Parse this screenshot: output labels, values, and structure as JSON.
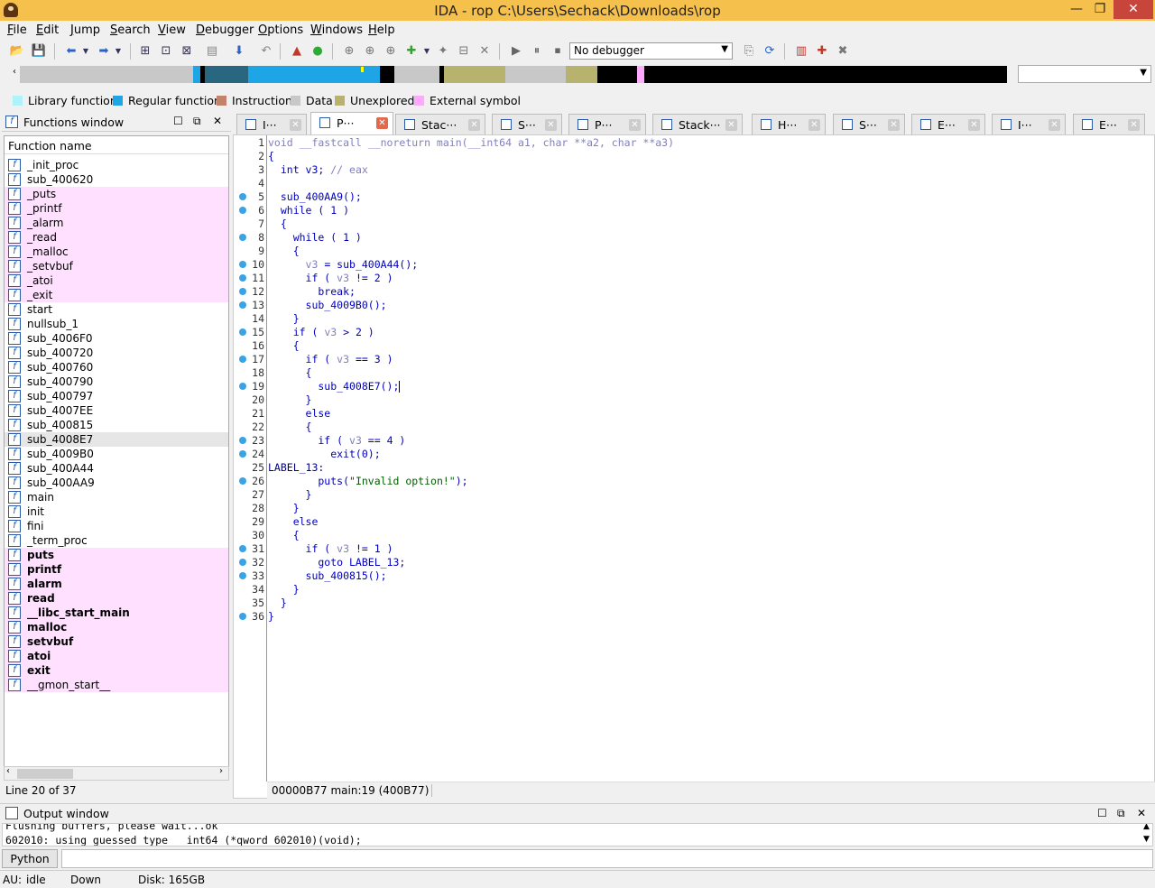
{
  "window": {
    "title": "IDA - rop C:\\Users\\Sechack\\Downloads\\rop",
    "min": "—",
    "max": "❐",
    "close": "✕"
  },
  "menu": [
    "File",
    "Edit",
    "Jump",
    "Search",
    "View",
    "Debugger",
    "Options",
    "Windows",
    "Help"
  ],
  "toolbar": {
    "debugger_select": "No debugger"
  },
  "legend": [
    {
      "label": "Library function",
      "color": "#aef3fb"
    },
    {
      "label": "Regular function",
      "color": "#1ea5e6"
    },
    {
      "label": "Instruction",
      "color": "#c3826c"
    },
    {
      "label": "Data",
      "color": "#c8c8c8"
    },
    {
      "label": "Unexplored",
      "color": "#b7b36e"
    },
    {
      "label": "External symbol",
      "color": "#ffaaff"
    }
  ],
  "functions_window": {
    "title": "Functions window",
    "column": "Function name",
    "status": "Line 20 of 37",
    "items": [
      {
        "name": "_init_proc",
        "style": "normal"
      },
      {
        "name": "sub_400620",
        "style": "normal"
      },
      {
        "name": "_puts",
        "style": "pink"
      },
      {
        "name": "_printf",
        "style": "pink"
      },
      {
        "name": "_alarm",
        "style": "pink"
      },
      {
        "name": "_read",
        "style": "pink"
      },
      {
        "name": "_malloc",
        "style": "pink"
      },
      {
        "name": "_setvbuf",
        "style": "pink"
      },
      {
        "name": "_atoi",
        "style": "pink"
      },
      {
        "name": "_exit",
        "style": "pink"
      },
      {
        "name": "start",
        "style": "normal"
      },
      {
        "name": "nullsub_1",
        "style": "normal"
      },
      {
        "name": "sub_4006F0",
        "style": "normal"
      },
      {
        "name": "sub_400720",
        "style": "normal"
      },
      {
        "name": "sub_400760",
        "style": "normal"
      },
      {
        "name": "sub_400790",
        "style": "normal"
      },
      {
        "name": "sub_400797",
        "style": "normal"
      },
      {
        "name": "sub_4007EE",
        "style": "normal"
      },
      {
        "name": "sub_400815",
        "style": "normal"
      },
      {
        "name": "sub_4008E7",
        "style": "selected"
      },
      {
        "name": "sub_4009B0",
        "style": "normal"
      },
      {
        "name": "sub_400A44",
        "style": "normal"
      },
      {
        "name": "sub_400AA9",
        "style": "normal"
      },
      {
        "name": "main",
        "style": "normal"
      },
      {
        "name": "init",
        "style": "normal"
      },
      {
        "name": "fini",
        "style": "normal"
      },
      {
        "name": "_term_proc",
        "style": "normal"
      },
      {
        "name": "puts",
        "style": "pinkbold"
      },
      {
        "name": "printf",
        "style": "pinkbold"
      },
      {
        "name": "alarm",
        "style": "pinkbold"
      },
      {
        "name": "read",
        "style": "pinkbold"
      },
      {
        "name": "__libc_start_main",
        "style": "pinkbold"
      },
      {
        "name": "malloc",
        "style": "pinkbold"
      },
      {
        "name": "setvbuf",
        "style": "pinkbold"
      },
      {
        "name": "atoi",
        "style": "pinkbold"
      },
      {
        "name": "exit",
        "style": "pinkbold"
      },
      {
        "name": "__gmon_start__",
        "style": "pink"
      }
    ]
  },
  "tabs": [
    {
      "label": "I···",
      "active": false
    },
    {
      "label": "P···",
      "active": true
    },
    {
      "label": "Stac···",
      "active": false
    },
    {
      "label": "S···",
      "active": false
    },
    {
      "label": "P···",
      "active": false
    },
    {
      "label": "Stack···",
      "active": false
    },
    {
      "label": "H···",
      "active": false
    },
    {
      "label": "S···",
      "active": false
    },
    {
      "label": "E···",
      "active": false
    },
    {
      "label": "I···",
      "active": false
    },
    {
      "label": "E···",
      "active": false
    }
  ],
  "pseudocode": {
    "status": "00000B77 main:19 (400B77)",
    "lines": [
      {
        "n": "1",
        "bp": false,
        "html": "<span class=\"c\">void __fastcall __noreturn main(__int64 a1, char **a2, char **a3)</span>"
      },
      {
        "n": "2",
        "bp": false,
        "html": "{"
      },
      {
        "n": "3",
        "bp": false,
        "html": "  int v3; <span class=\"c\">// eax</span>"
      },
      {
        "n": "4",
        "bp": false,
        "html": ""
      },
      {
        "n": "5",
        "bp": true,
        "html": "  sub_400AA9();"
      },
      {
        "n": "6",
        "bp": true,
        "html": "  while ( 1 )"
      },
      {
        "n": "7",
        "bp": false,
        "html": "  {"
      },
      {
        "n": "8",
        "bp": true,
        "html": "    while ( 1 )"
      },
      {
        "n": "9",
        "bp": false,
        "html": "    {"
      },
      {
        "n": "10",
        "bp": true,
        "html": "      <span class=\"v\">v3</span> = sub_400A44();"
      },
      {
        "n": "11",
        "bp": true,
        "html": "      if ( <span class=\"v\">v3</span> != 2 )"
      },
      {
        "n": "12",
        "bp": true,
        "html": "        break;"
      },
      {
        "n": "13",
        "bp": true,
        "html": "      sub_4009B0();"
      },
      {
        "n": "14",
        "bp": false,
        "html": "    }"
      },
      {
        "n": "15",
        "bp": true,
        "html": "    if ( <span class=\"v\">v3</span> > 2 )"
      },
      {
        "n": "16",
        "bp": false,
        "html": "    {"
      },
      {
        "n": "17",
        "bp": true,
        "html": "      if ( <span class=\"v\">v3</span> == 3 )"
      },
      {
        "n": "18",
        "bp": false,
        "html": "      {"
      },
      {
        "n": "19",
        "bp": true,
        "html": "        sub_4008E7();"
      },
      {
        "n": "20",
        "bp": false,
        "html": "      }"
      },
      {
        "n": "21",
        "bp": false,
        "html": "      else"
      },
      {
        "n": "22",
        "bp": false,
        "html": "      {"
      },
      {
        "n": "23",
        "bp": true,
        "html": "        if ( <span class=\"v\">v3</span> == 4 )"
      },
      {
        "n": "24",
        "bp": true,
        "html": "          exit(0);"
      },
      {
        "n": "25",
        "bp": false,
        "html": "<span class=\"lbl\">LABEL_13:</span>"
      },
      {
        "n": "26",
        "bp": true,
        "html": "        puts(<span class=\"s\">\"Invalid option!\"</span>);"
      },
      {
        "n": "27",
        "bp": false,
        "html": "      }"
      },
      {
        "n": "28",
        "bp": false,
        "html": "    }"
      },
      {
        "n": "29",
        "bp": false,
        "html": "    else"
      },
      {
        "n": "30",
        "bp": false,
        "html": "    {"
      },
      {
        "n": "31",
        "bp": true,
        "html": "      if ( <span class=\"v\">v3</span> != 1 )"
      },
      {
        "n": "32",
        "bp": true,
        "html": "        goto LABEL_13;"
      },
      {
        "n": "33",
        "bp": true,
        "html": "      sub_400815();"
      },
      {
        "n": "34",
        "bp": false,
        "html": "    }"
      },
      {
        "n": "35",
        "bp": false,
        "html": "  }"
      },
      {
        "n": "36",
        "bp": true,
        "html": "}"
      }
    ]
  },
  "output": {
    "title": "Output window",
    "lines": [
      "Flushing buffers, please wait...ok",
      "602010: using guessed type __int64 (*qword_602010)(void);"
    ],
    "python_button": "Python"
  },
  "status": {
    "au": "AU:",
    "state": "idle",
    "direction": "Down",
    "disk": "Disk: 165GB"
  }
}
